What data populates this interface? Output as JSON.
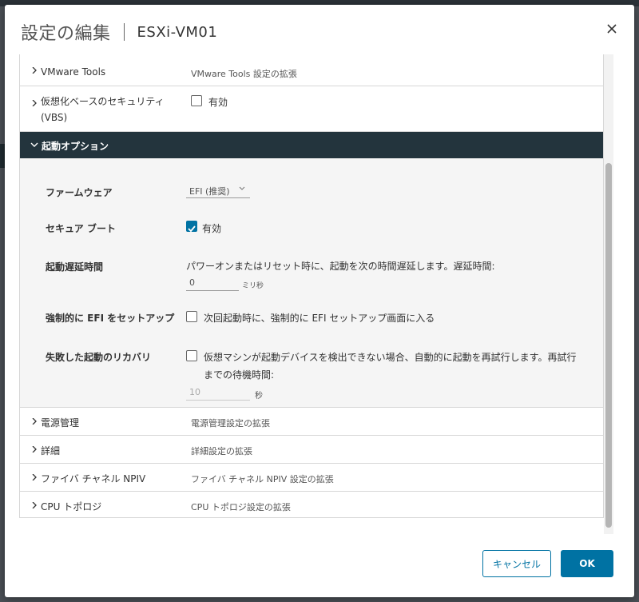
{
  "dialog": {
    "title": "設定の編集",
    "vm_name": "ESXi-VM01"
  },
  "rows_top": [
    {
      "label": "VMware Tools",
      "desc": "VMware Tools 設定の拡張"
    },
    {
      "label": "仮想化ベースのセキュリティ",
      "label2": "(VBS)",
      "checkbox_label": "有効",
      "checked": false
    }
  ],
  "boot_options": {
    "header": "起動オプション",
    "firmware": {
      "label": "ファームウェア",
      "value": "EFI (推奨)"
    },
    "secure_boot": {
      "label": "セキュア ブート",
      "checkbox_label": "有効",
      "checked": true
    },
    "boot_delay": {
      "label": "起動遅延時間",
      "desc": "パワーオンまたはリセット時に、起動を次の時間遅延します。遅延時間:",
      "value": "0",
      "unit": "ミリ秒"
    },
    "force_efi": {
      "label": "強制的に EFI をセットアップ",
      "checkbox_label": "次回起動時に、強制的に EFI セットアップ画面に入る",
      "checked": false
    },
    "failed_boot": {
      "label": "失敗した起動のリカバリ",
      "checkbox_label_line1": "仮想マシンが起動デバイスを検出できない場合、自動的に起動を再試行します。再試行",
      "checkbox_label_line2": "までの待機時間:",
      "checked": false,
      "value": "10",
      "unit": "秒"
    }
  },
  "rows_bottom": [
    {
      "label": "電源管理",
      "desc": "電源管理設定の拡張"
    },
    {
      "label": "詳細",
      "desc": "詳細設定の拡張"
    },
    {
      "label": "ファイバ チャネル NPIV",
      "desc": "ファイバ チャネル NPIV 設定の拡張"
    },
    {
      "label": "CPU トポロジ",
      "desc": "CPU トポロジ設定の拡張"
    }
  ],
  "footer": {
    "cancel_label": "キャンセル",
    "ok_label": "OK"
  },
  "colors": {
    "accent": "#0072a3",
    "section_header_bg": "#23343d"
  }
}
